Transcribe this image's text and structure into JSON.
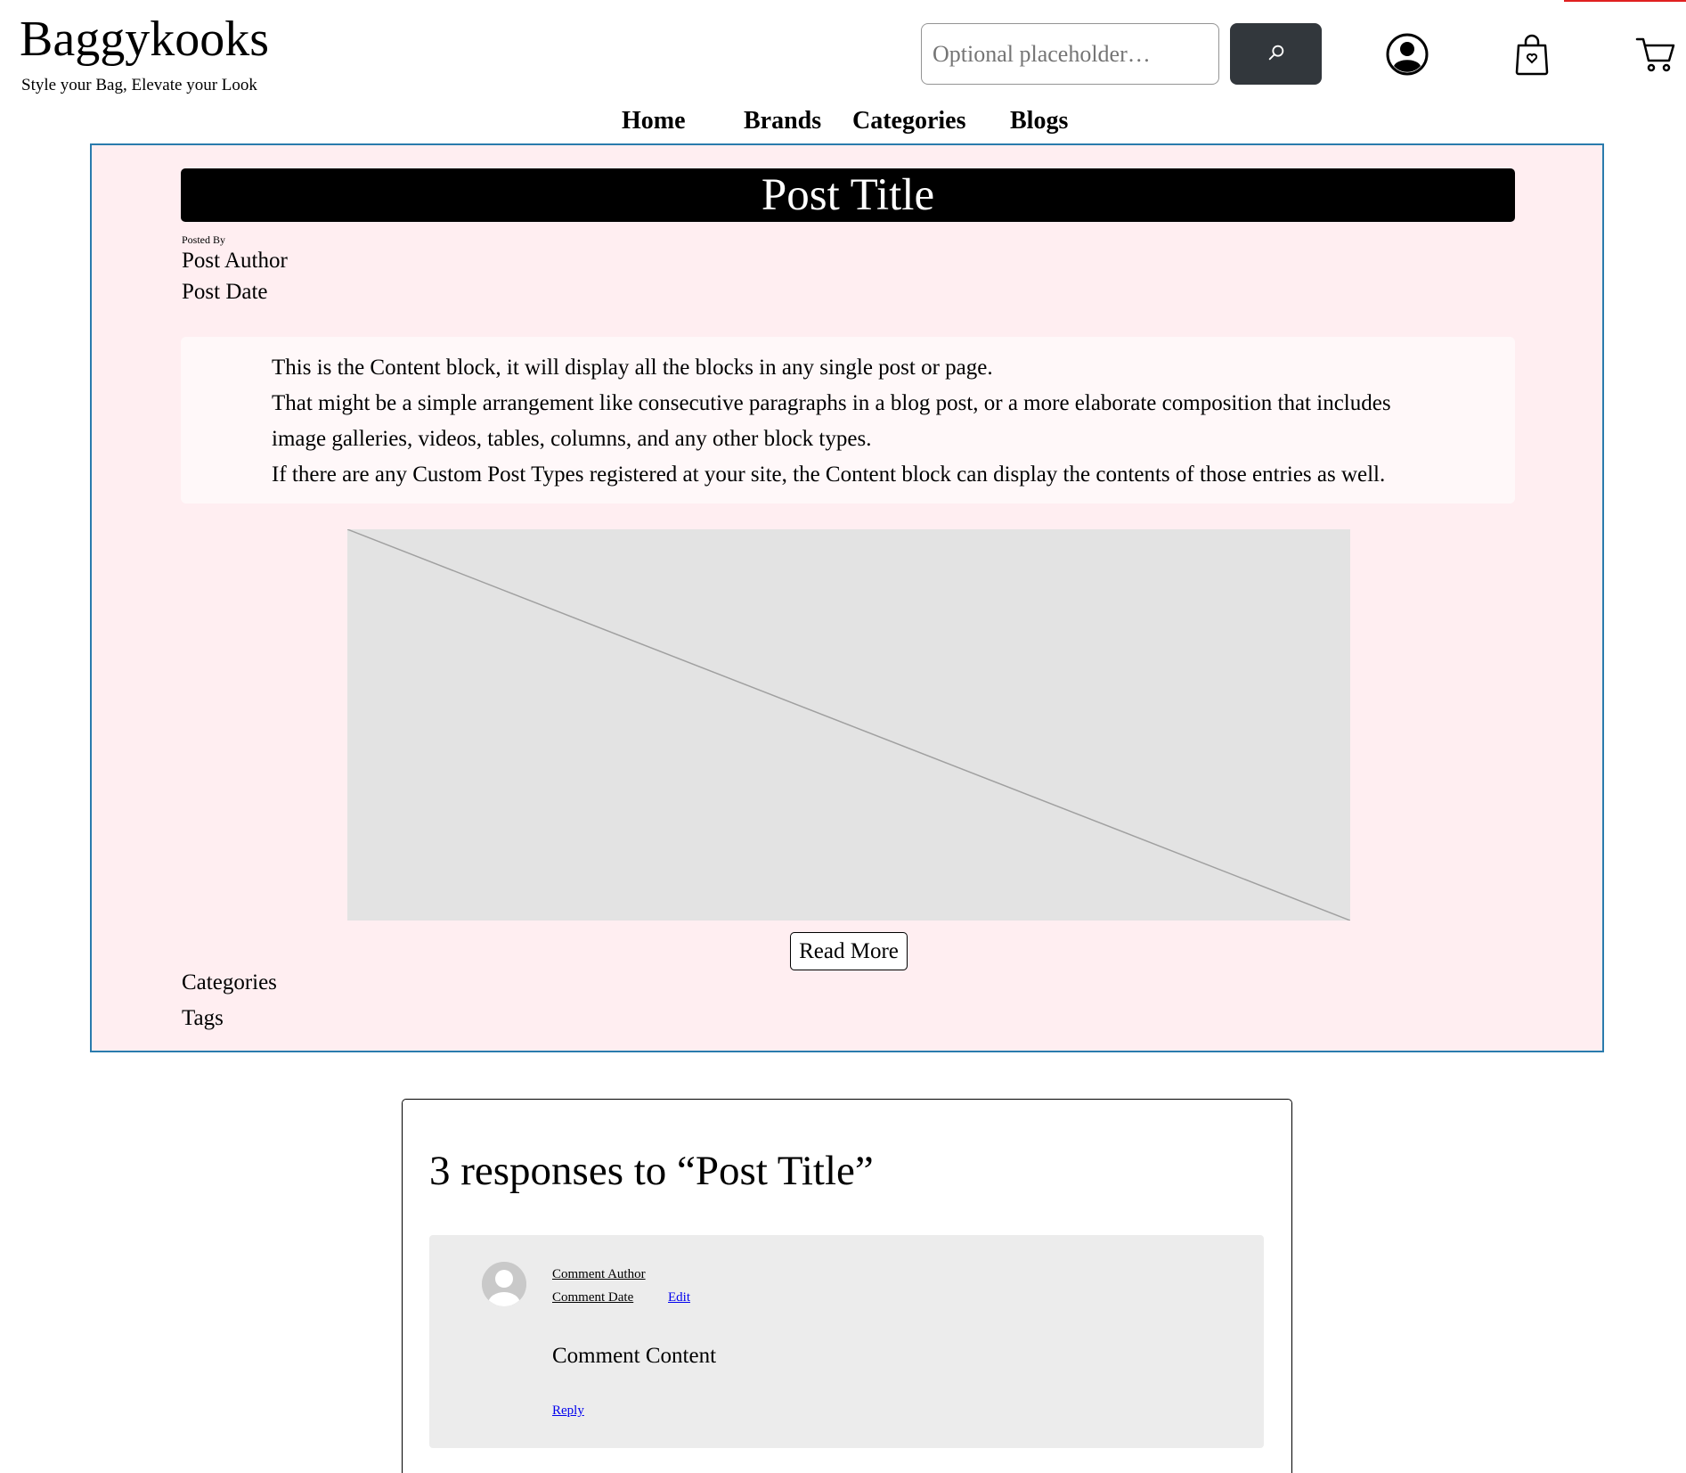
{
  "site": {
    "title": "Baggykooks",
    "tagline": "Style your Bag, Elevate your Look"
  },
  "header": {
    "search": {
      "placeholder": "Optional placeholder…",
      "value": "",
      "button_icon": "search-icon"
    },
    "icons": {
      "account": "account-circle-icon",
      "bag": "shopping-bag-heart-icon",
      "cart": "shopping-cart-icon"
    }
  },
  "nav": {
    "items": [
      {
        "label": "Home"
      },
      {
        "label": "Brands"
      },
      {
        "label": "Categories"
      },
      {
        "label": "Blogs"
      }
    ]
  },
  "post": {
    "title": "Post Title",
    "posted_by_label": "Posted By",
    "author": "Post Author",
    "date": "Post Date",
    "content": [
      "This is the Content block, it will display all the blocks in any single post or page.",
      "That might be a simple arrangement like consecutive paragraphs in a blog post, or a more elaborate composition that includes",
      "image galleries, videos, tables, columns, and any other block types.",
      "If there are any Custom Post Types registered at your site, the Content block can display the contents of those entries as well."
    ],
    "read_more_label": "Read More",
    "categories_label": "Categories",
    "tags_label": "Tags"
  },
  "comments": {
    "heading": "3 responses to “Post Title”",
    "items": [
      {
        "author": "Comment Author",
        "date": "Comment Date",
        "edit_label": "Edit",
        "content": "Comment Content",
        "reply_label": "Reply"
      }
    ]
  },
  "colors": {
    "accent_line": "#e02020",
    "search_button_bg": "#32373c",
    "post_card_bg": "#ffeef1",
    "post_card_border": "#2a7bad",
    "content_block_bg": "#fff8f9",
    "comment_bg": "#ececec",
    "link": "#0000ee"
  }
}
